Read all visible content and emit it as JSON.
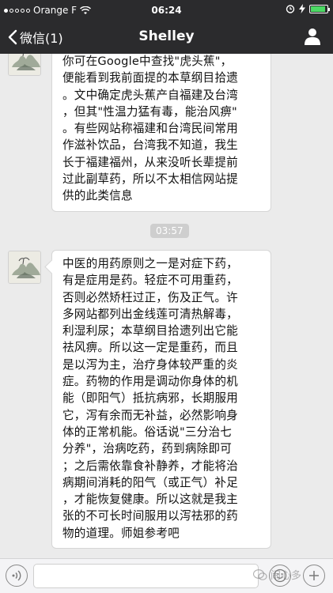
{
  "status_bar": {
    "carrier": "Orange F",
    "time": "06:24",
    "battery_level": 0.9,
    "battery_color": "#4cd964"
  },
  "nav": {
    "back_label": "微信(1)",
    "title": "Shelley",
    "profile_icon": "person-icon"
  },
  "messages": [
    {
      "sender": "Shelley",
      "text": "你可在Google中查找\"虎头蕉\"，\n便能看到我前面提的本草纲目拾遗\n。文中确定虎头蕉产自福建及台湾\n，但其\"性温力猛有毒，能治风痹\"\n。有些网站称福建和台湾民间常用\n作滋补饮品，台湾我不知道，我生\n长于福建福州，从来没听长辈提前\n过此副草药，所以不太相信网站提\n供的此类信息"
    },
    {
      "sender": "Shelley",
      "text": "中医的用药原则之一是对症下药，\n有是症用是药。轻症不可用重药，\n否则必然矫枉过正，伤及正气。许\n多网站都列出金线莲可清热解毒，\n利湿利尿；本草纲目拾遗列出它能\n祛风痹。所以这一定是重药，而且\n是以泻为主，治疗身体较严重的炎\n症。药物的作用是调动你身体的机\n能（即阳气）抵抗病邪，长期服用\n它，泻有余而无补益，必然影响身\n体的正常机能。俗话说\"三分治七\n分养\"，治病吃药，药到病除即可\n；之后需依靠食补静养，才能将治\n病期间消耗的阳气（或正气）补足\n，才能恢复健康。所以这就是我主\n张的不可长时间服用以泻祛邪的药\n物的道理。师姐参考吧"
    }
  ],
  "timestamp": "03:57",
  "input": {
    "placeholder": ""
  },
  "watermark": "闹心多"
}
